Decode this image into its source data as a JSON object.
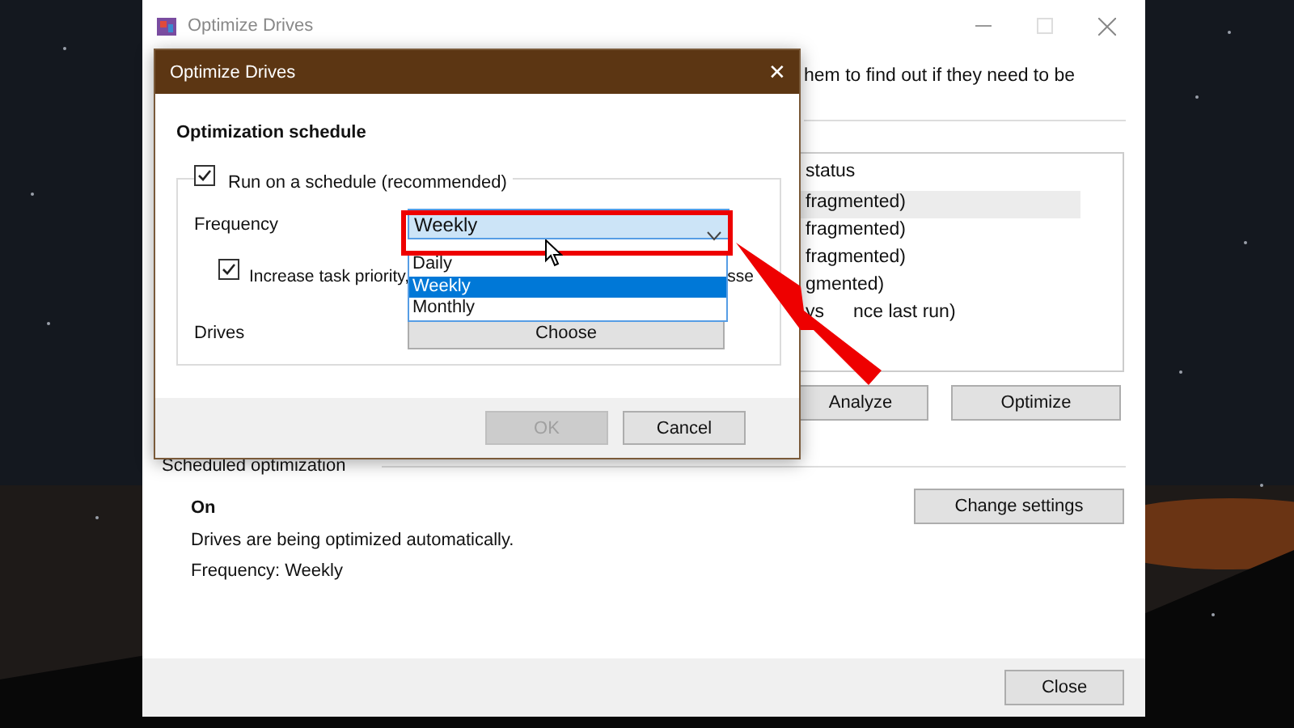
{
  "window": {
    "title": "Optimize Drives",
    "description": "hem to find out if they need to be"
  },
  "drives_table": {
    "column": "status",
    "rows": [
      {
        "status": "fragmented)",
        "selected": true
      },
      {
        "status": "fragmented)",
        "selected": false
      },
      {
        "status": "fragmented)",
        "selected": false
      },
      {
        "status": "gmented)",
        "selected": false
      },
      {
        "status": "ys",
        "status_continued": "nce last run)",
        "selected": false
      }
    ]
  },
  "actions": [
    "Analyze",
    "Optimize"
  ],
  "scheduled": {
    "heading": "Scheduled optimization",
    "state": "On",
    "message": "Drives are being optimized automatically.",
    "frequency": "Frequency: Weekly",
    "button": "Change settings"
  },
  "footer_button": "Close",
  "dialog": {
    "title": "Optimize Drives",
    "close": "✕",
    "heading": "Optimization schedule",
    "run_on_schedule": {
      "label": "Run on a schedule (recommended)",
      "checked": true
    },
    "frequency": {
      "label": "Frequency",
      "value": "Weekly",
      "expanded": true,
      "options": [
        {
          "label": "Daily",
          "selected": false
        },
        {
          "label": "Weekly",
          "selected": true
        },
        {
          "label": "Monthly",
          "selected": false
        }
      ]
    },
    "priority": {
      "label": "Increase task priority,",
      "tail": "sse",
      "checked": true
    },
    "drives": {
      "label": "Drives",
      "button": "Choose"
    },
    "buttons": [
      {
        "label": "OK",
        "disabled": true
      },
      {
        "label": "Cancel",
        "disabled": false
      }
    ]
  }
}
